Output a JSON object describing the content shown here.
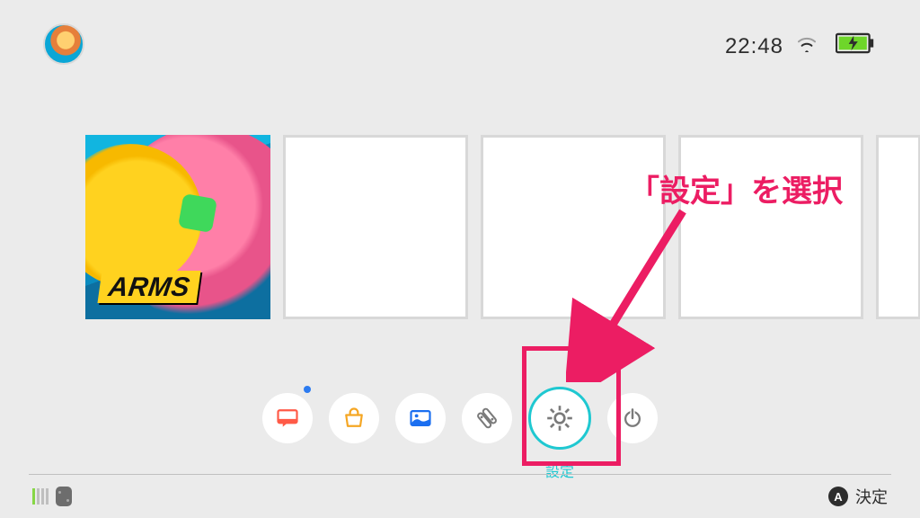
{
  "header": {
    "clock": "22:48",
    "wifi_strength": 2,
    "battery_charging": true
  },
  "tiles": {
    "game_title_logo": "ARMS"
  },
  "dock": {
    "news": {
      "name": "news",
      "has_notification": true
    },
    "eshop": {
      "name": "eshop"
    },
    "album": {
      "name": "album"
    },
    "controllers": {
      "name": "controllers"
    },
    "settings": {
      "name": "settings",
      "label": "設定",
      "selected": true
    },
    "power": {
      "name": "power"
    }
  },
  "footer": {
    "confirm_button_glyph": "A",
    "confirm_label": "決定"
  },
  "annotation": {
    "text": "「設定」を選択"
  }
}
